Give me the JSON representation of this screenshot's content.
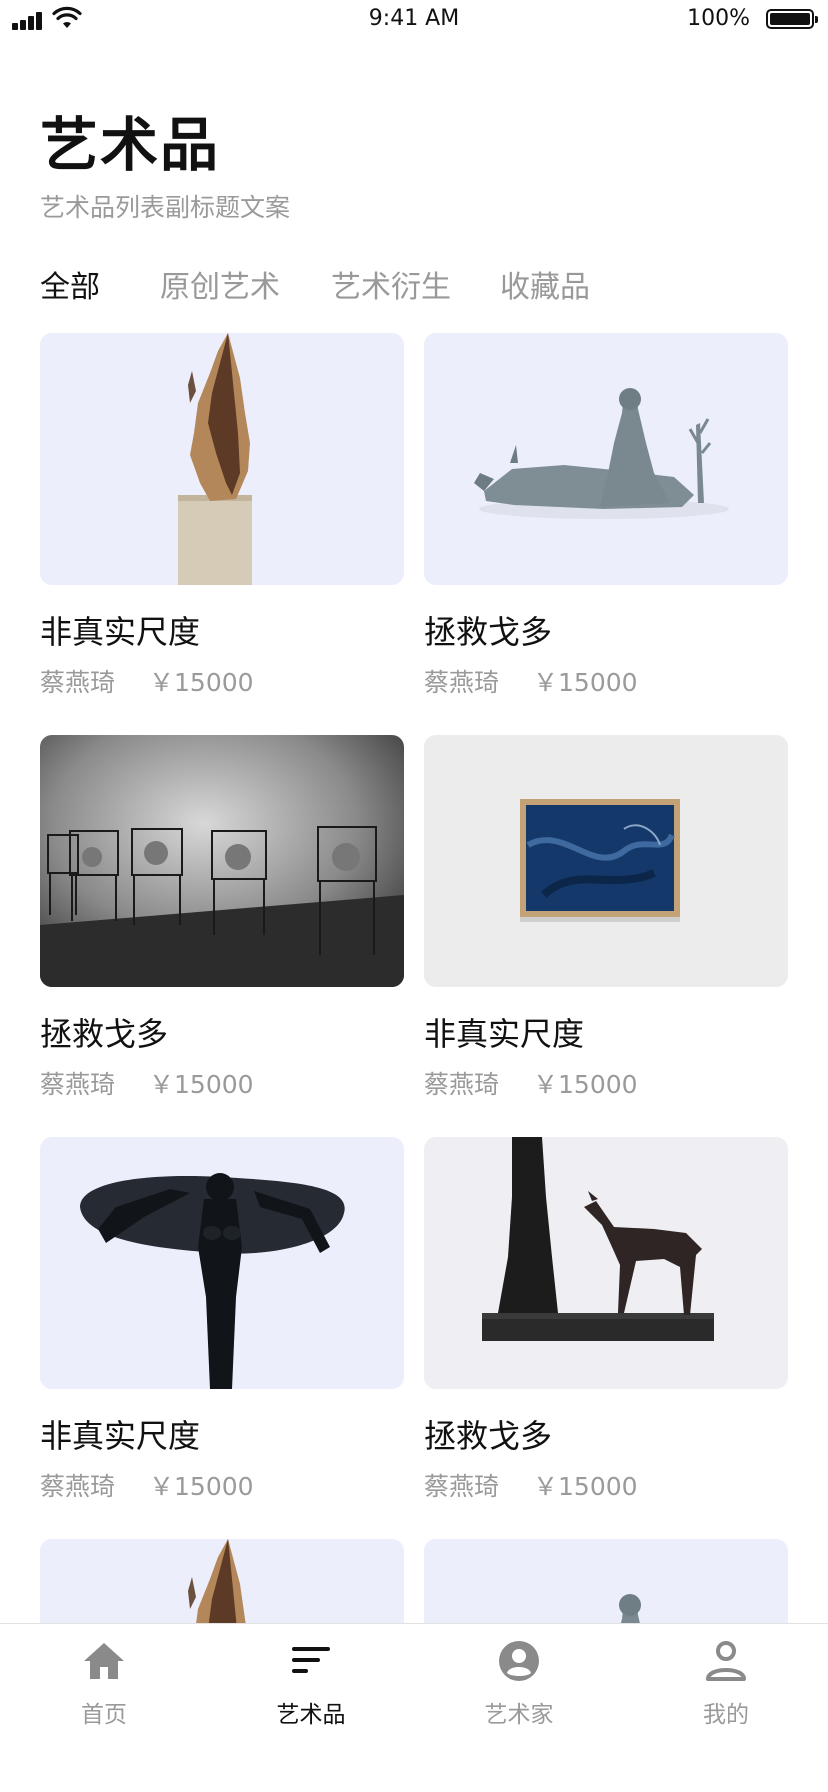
{
  "status_bar": {
    "time": "9:41 AM",
    "battery_percent": "100%"
  },
  "header": {
    "title": "艺术品",
    "subtitle": "艺术品列表副标题文案"
  },
  "tabs": [
    {
      "label": "全部",
      "active": true
    },
    {
      "label": "原创艺术",
      "active": false
    },
    {
      "label": "艺术衍生",
      "active": false
    },
    {
      "label": "收藏品",
      "active": false
    }
  ],
  "artworks": [
    {
      "title": "非真实尺度",
      "artist": "蔡燕琦",
      "price": "￥15000",
      "image": "wood-sculpture"
    },
    {
      "title": "拯救戈多",
      "artist": "蔡燕琦",
      "price": "￥15000",
      "image": "figure-with-ox"
    },
    {
      "title": "拯救戈多",
      "artist": "蔡燕琦",
      "price": "￥15000",
      "image": "gallery-glass-cases"
    },
    {
      "title": "非真实尺度",
      "artist": "蔡燕琦",
      "price": "￥15000",
      "image": "framed-blue-painting"
    },
    {
      "title": "非真实尺度",
      "artist": "蔡燕琦",
      "price": "￥15000",
      "image": "bronze-female-figure"
    },
    {
      "title": "拯救戈多",
      "artist": "蔡燕琦",
      "price": "￥15000",
      "image": "horse-and-tree"
    },
    {
      "title": "",
      "artist": "",
      "price": "",
      "image": "wood-sculpture"
    },
    {
      "title": "",
      "artist": "",
      "price": "",
      "image": "figure-with-ox"
    }
  ],
  "tabbar": [
    {
      "label": "首页",
      "icon": "home-icon",
      "active": false
    },
    {
      "label": "艺术品",
      "icon": "list-icon",
      "active": true
    },
    {
      "label": "艺术家",
      "icon": "artist-avatar-icon",
      "active": false
    },
    {
      "label": "我的",
      "icon": "person-icon",
      "active": false
    }
  ],
  "colors": {
    "text_primary": "#111111",
    "text_secondary": "#9a9a9a",
    "card_background": "#eceefb",
    "divider": "#e2e2e2",
    "icon_inactive": "#8a8a8a"
  }
}
